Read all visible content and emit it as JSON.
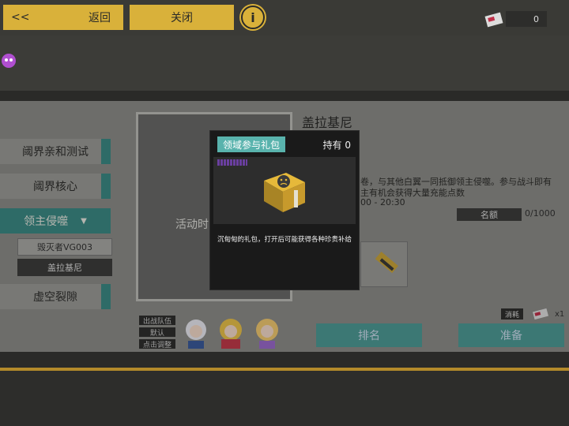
{
  "topbar": {
    "back_arrows": "<<",
    "back_label": "返回",
    "close_label": "关闭",
    "info_label": "i",
    "currency_value": "0"
  },
  "nav": {
    "items": [
      "阈界亲和测试",
      "阈界核心",
      "领主侵噬",
      "虚空裂隙"
    ],
    "active_arrow": "▼",
    "sub_items": [
      "毁灭者VG003",
      "盖拉基尼"
    ]
  },
  "map_card": {
    "title": "活动时"
  },
  "boss": {
    "name": "盖拉基尼",
    "desc_fragment_1": "卷，与其他白翼一同抵御领主侵噬。参与战斗即有",
    "desc_fragment_2": "主有机会获得大量充能点数",
    "time_fragment": "00 - 20:30",
    "quota_label": "名额",
    "quota_value": "0/1000"
  },
  "cost": {
    "label": "消耗",
    "count": "x1"
  },
  "buttons": {
    "rank": "排名",
    "ready": "准备"
  },
  "team": {
    "labels": [
      "出战队伍",
      "默认",
      "点击调整"
    ]
  },
  "popup": {
    "title": "领域参与礼包",
    "holding": "持有 0",
    "description": "沉甸甸的礼包，打开后可能获得各种珍贵补给"
  },
  "colors": {
    "accent_gold": "#d9b13a",
    "accent_teal": "#4d9a95",
    "popup_title_bg": "#59b3ad"
  }
}
